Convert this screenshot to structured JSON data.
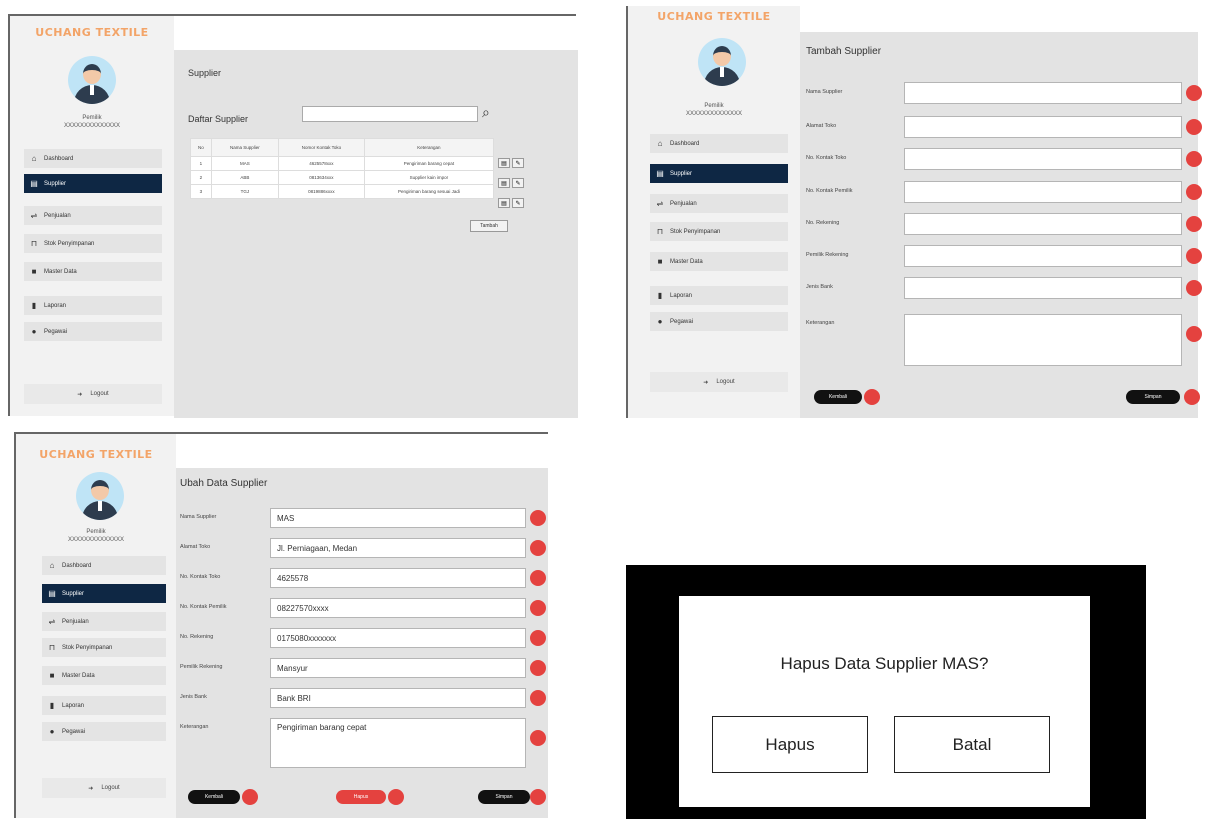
{
  "brand": "UCHANG TEXTILE",
  "user": {
    "name": "Pemilik",
    "id": "XXXXXXXXXXXXXX"
  },
  "nav": [
    {
      "label": "Dashboard",
      "icon": "home-icon"
    },
    {
      "label": "Supplier",
      "icon": "shop-icon"
    },
    {
      "label": "Penjualan",
      "icon": "handshake-icon"
    },
    {
      "label": "Stok Penyimpanan",
      "icon": "cart-icon"
    },
    {
      "label": "Master Data",
      "icon": "folder-icon"
    },
    {
      "label": "Laporan",
      "icon": "file-icon"
    },
    {
      "label": "Pegawai",
      "icon": "user-icon"
    }
  ],
  "logout": "Logout",
  "list_screen": {
    "title": "Supplier",
    "subtitle": "Daftar Supplier",
    "search_placeholder": "",
    "columns": [
      "No",
      "Nama Supplier",
      "Nomor Kontak Toko",
      "Keterangan"
    ],
    "rows": [
      [
        "1",
        "MAS",
        "4625578xxx",
        "Pengiriman barang cepat"
      ],
      [
        "2",
        "ABB",
        "0813634xxx",
        "Supplier kain impor"
      ],
      [
        "3",
        "TGJ",
        "0819886xxxx",
        "Pengiriman barang sesuai Jadi"
      ]
    ],
    "tambah": "Tambah"
  },
  "add_screen": {
    "title": "Tambah Supplier",
    "labels": [
      "Nama Supplier",
      "Alamat Toko",
      "No. Kontak Toko",
      "No. Kontak Pemilik",
      "No. Rekening",
      "Pemilik Rekening",
      "Jenis Bank",
      "Keterangan"
    ],
    "kembali": "Kembali",
    "simpan": "Simpan"
  },
  "edit_screen": {
    "title": "Ubah Data Supplier",
    "labels": [
      "Nama Supplier",
      "Alamat Toko",
      "No. Kontak Toko",
      "No. Kontak Pemilik",
      "No. Rekening",
      "Pemilik Rekening",
      "Jenis Bank",
      "Keterangan"
    ],
    "values": [
      "MAS",
      "Jl. Perniagaan, Medan",
      "4625578",
      "08227570xxxx",
      "0175080xxxxxxx",
      "Mansyur",
      "Bank BRI",
      "Pengiriman barang cepat"
    ],
    "kembali": "Kembali",
    "hapus": "Hapus",
    "simpan": "Simpan"
  },
  "dialog": {
    "message": "Hapus Data Supplier MAS?",
    "hapus": "Hapus",
    "batal": "Batal"
  }
}
